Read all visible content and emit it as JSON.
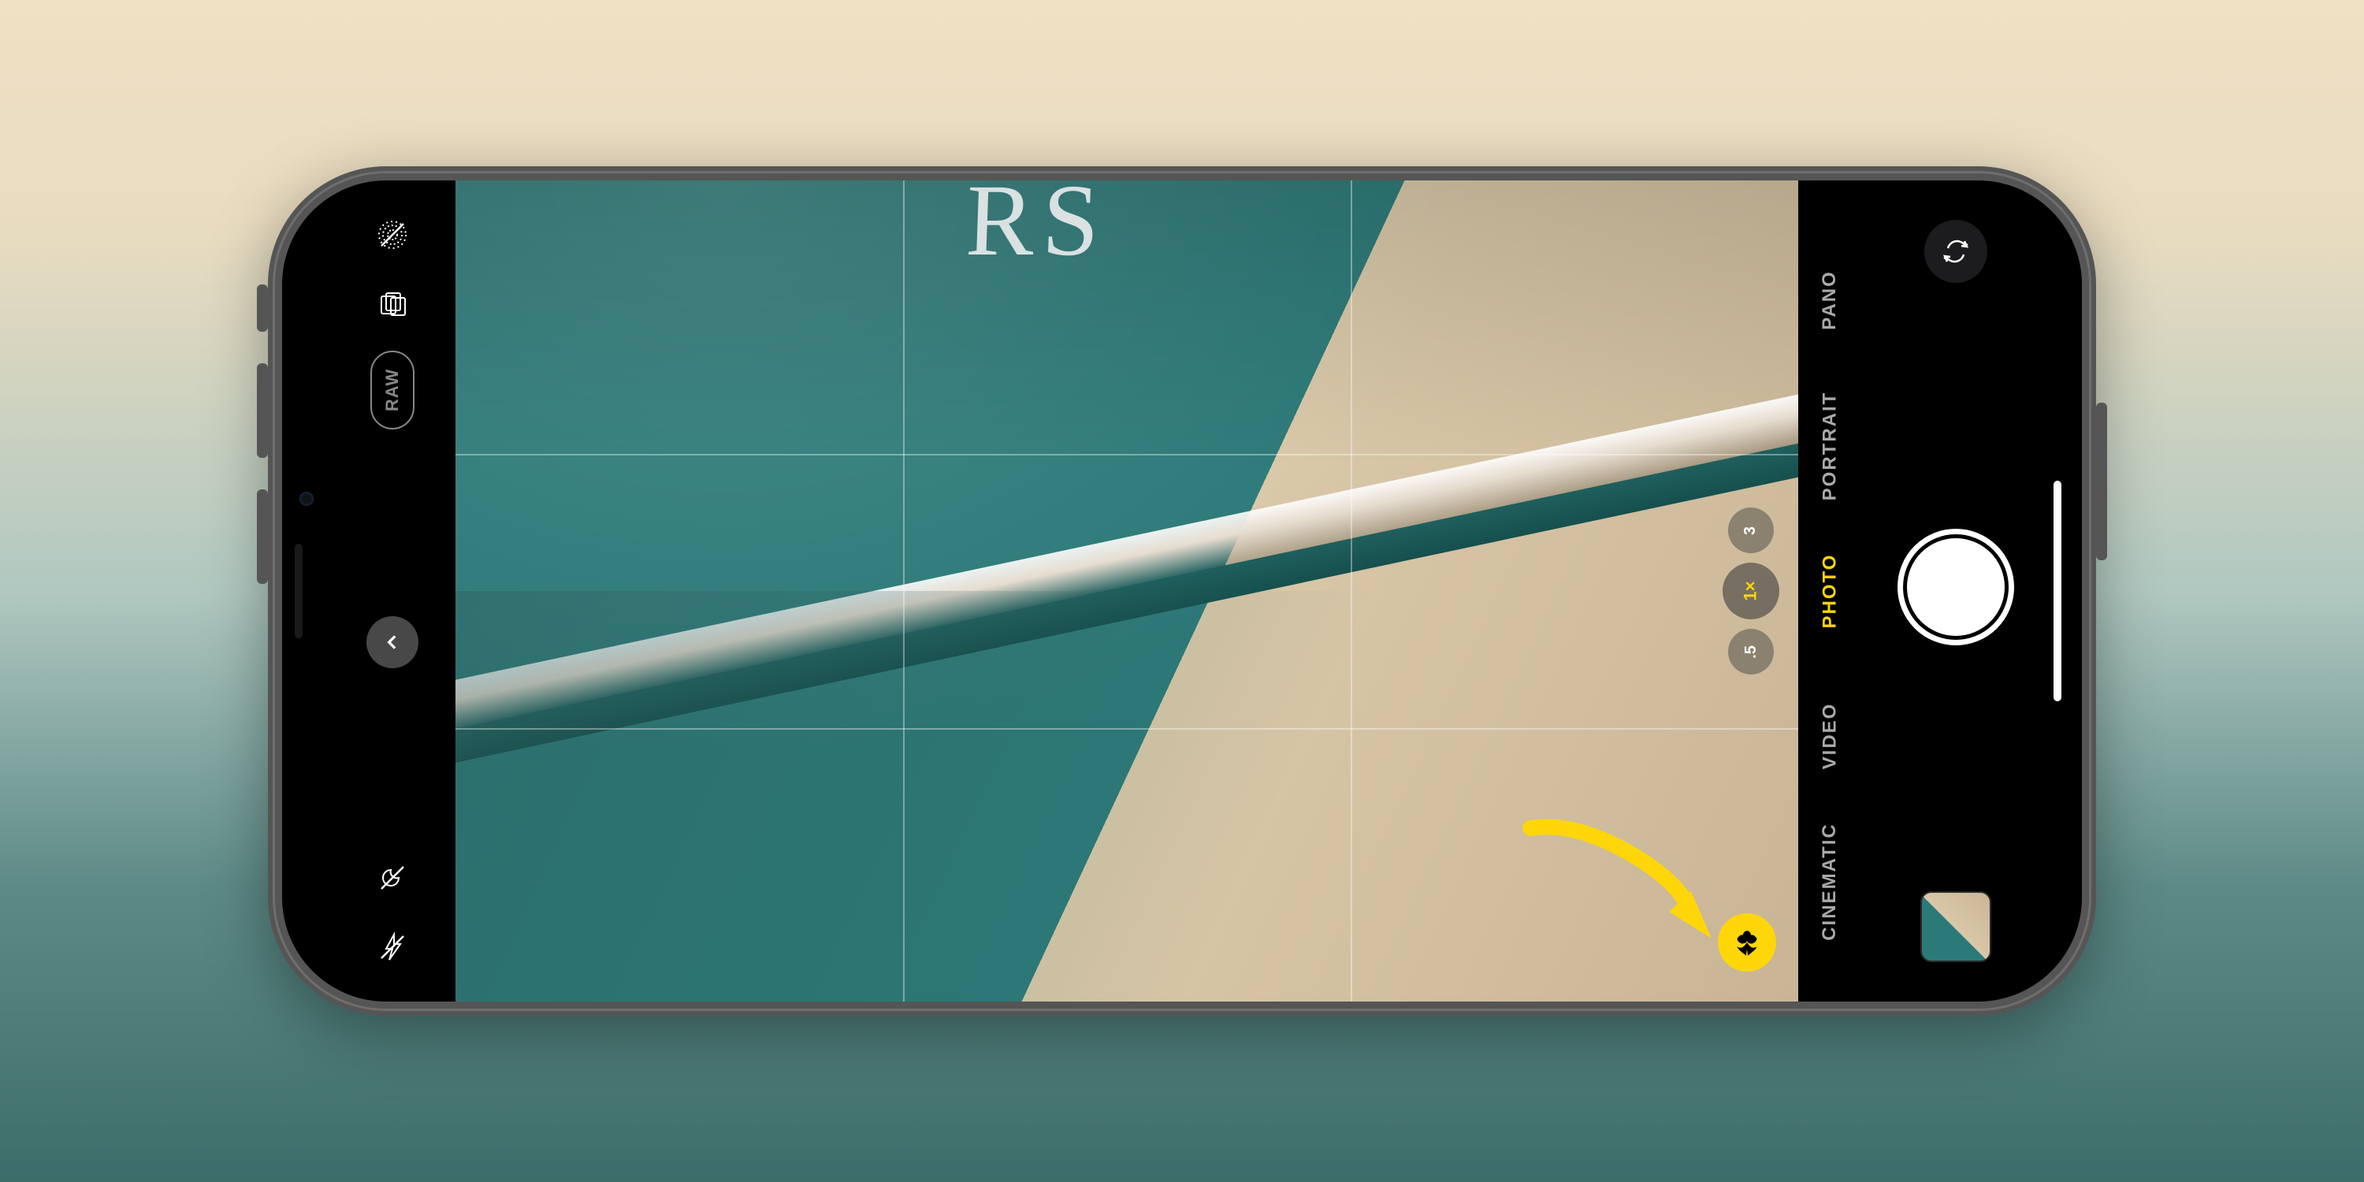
{
  "toolbar": {
    "raw_label": "RAW"
  },
  "zoom": {
    "tele": "3",
    "wide": "1×",
    "ultrawide": ".5"
  },
  "modes": {
    "pano": "PANO",
    "portrait": "PORTRAIT",
    "photo": "PHOTO",
    "video": "VIDEO",
    "cinematic": "CINEMATIC"
  },
  "viewfinder": {
    "book_title_fragment": "RS"
  },
  "colors": {
    "accent": "#ffd60a"
  }
}
